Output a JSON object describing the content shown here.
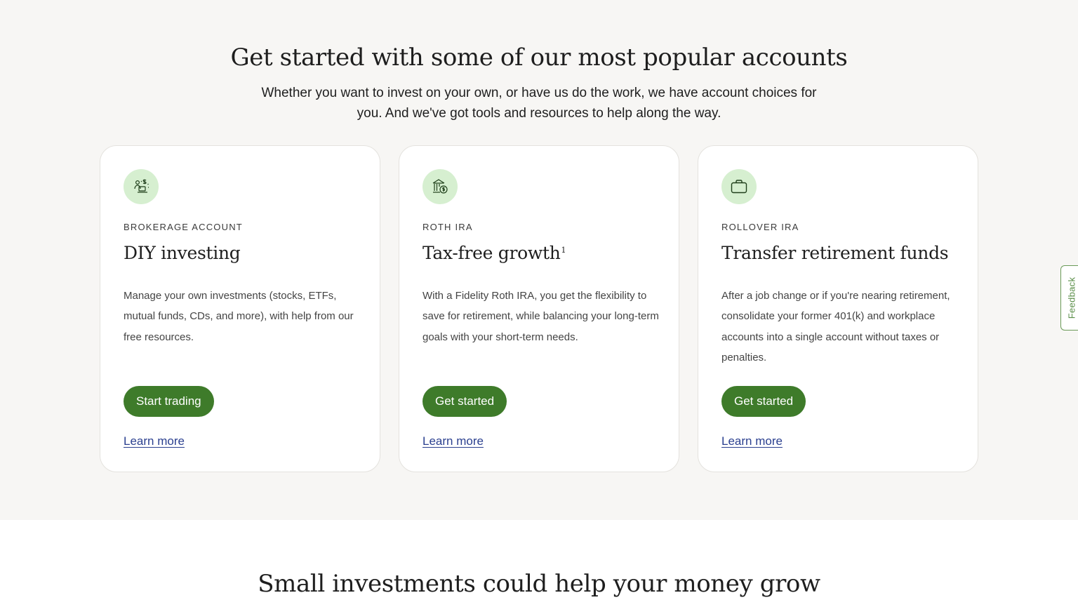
{
  "accounts_section": {
    "title": "Get started with some of our most popular accounts",
    "subtitle": "Whether you want to invest on your own, or have us do the work, we have account choices for you. And we've got tools and resources to help along the way.",
    "cards": [
      {
        "icon": "brokerage-icon",
        "eyebrow": "BROKERAGE ACCOUNT",
        "headline": "DIY investing",
        "footnote": "",
        "description": "Manage your own investments (stocks, ETFs, mutual funds, CDs, and more), with help from our free resources.",
        "cta_label": "Start trading",
        "link_label": "Learn more"
      },
      {
        "icon": "bank-dollar-icon",
        "eyebrow": "ROTH IRA",
        "headline": "Tax-free growth",
        "footnote": "1",
        "description": "With a Fidelity Roth IRA, you get the flexibility to save for retirement, while balancing your long-term goals with your short-term needs.",
        "cta_label": "Get started",
        "link_label": "Learn more"
      },
      {
        "icon": "briefcase-icon",
        "eyebrow": "ROLLOVER IRA",
        "headline": "Transfer retirement funds",
        "footnote": "",
        "description": "After a job change or if you're nearing retirement, consolidate your former 401(k) and workplace accounts into a single account without taxes or penalties.",
        "cta_label": "Get started",
        "link_label": "Learn more"
      }
    ]
  },
  "feedback_tab": {
    "label": "Feedback"
  },
  "next_section": {
    "title": "Small investments could help your money grow"
  },
  "colors": {
    "band_bg": "#f7f6f4",
    "accent_green": "#3e7b2a",
    "icon_circle": "#d6efd0",
    "link_blue": "#2a3f8f"
  }
}
